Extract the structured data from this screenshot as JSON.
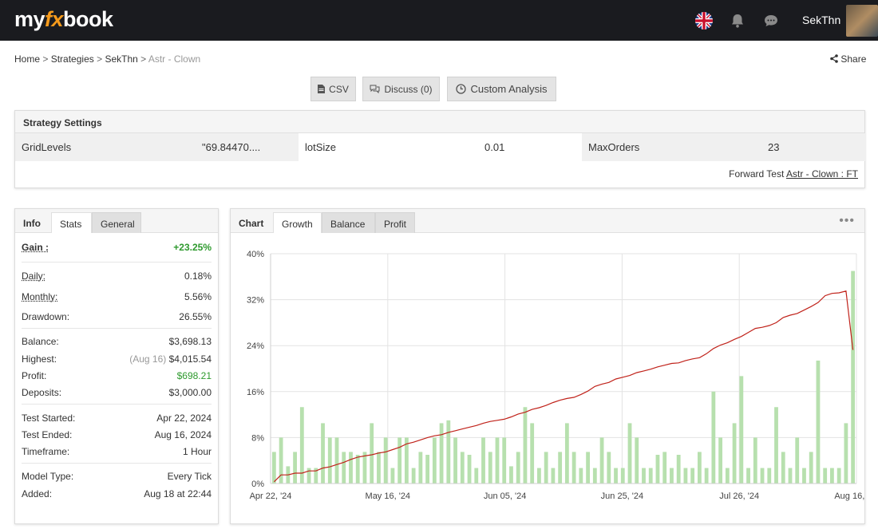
{
  "header": {
    "logo_pre": "my",
    "logo_fx": "fx",
    "logo_post": "book",
    "username": "SekThn"
  },
  "breadcrumb": {
    "home": "Home",
    "strategies": "Strategies",
    "user": "SekThn",
    "current": "Astr - Clown",
    "sep": ">"
  },
  "share_label": "Share",
  "toolbar": {
    "csv_label": "CSV",
    "discuss_label": "Discuss (0)",
    "analysis_label": "Custom Analysis"
  },
  "settings": {
    "title": "Strategy Settings",
    "params": [
      {
        "name": "GridLevels",
        "value": "\"69.84470...."
      },
      {
        "name": "lotSize",
        "value": "0.01"
      },
      {
        "name": "MaxOrders",
        "value": "23"
      }
    ],
    "forward_test_label": "Forward Test",
    "forward_test_link": "Astr - Clown : FT"
  },
  "left_tabs": [
    "Info",
    "Stats",
    "General"
  ],
  "stats": {
    "gain_label": "Gain :",
    "gain": "+23.25%",
    "daily_label": "Daily:",
    "daily": "0.18%",
    "monthly_label": "Monthly:",
    "monthly": "5.56%",
    "drawdown_label": "Drawdown:",
    "drawdown": "26.55%",
    "balance_label": "Balance:",
    "balance": "$3,698.13",
    "highest_label": "Highest:",
    "highest_date": "(Aug 16)",
    "highest": "$4,015.54",
    "profit_label": "Profit:",
    "profit": "$698.21",
    "deposits_label": "Deposits:",
    "deposits": "$3,000.00",
    "test_started_label": "Test Started:",
    "test_started": "Apr 22, 2024",
    "test_ended_label": "Test Ended:",
    "test_ended": "Aug 16, 2024",
    "timeframe_label": "Timeframe:",
    "timeframe": "1 Hour",
    "model_type_label": "Model Type:",
    "model_type": "Every Tick",
    "added_label": "Added:",
    "added": "Aug 18 at 22:44"
  },
  "chart_tabs": [
    "Chart",
    "Growth",
    "Balance",
    "Profit"
  ],
  "colors": {
    "line": "#c0221a",
    "bar": "#b7e0ae",
    "gain_green": "#2e9a2e",
    "logo_accent": "#f59a1b"
  },
  "chart_data": {
    "type": "bar",
    "ylim": [
      0,
      40
    ],
    "yticks": [
      "0%",
      "8%",
      "16%",
      "24%",
      "32%",
      "40%"
    ],
    "xticks": [
      "Apr 22, '24",
      "May 16, '24",
      "Jun 05, '24",
      "Jun 25, '24",
      "Jul 26, '24",
      "Aug 16, '24"
    ],
    "grid": true,
    "series": [
      {
        "values": [
          5.5,
          8,
          3,
          5.5,
          13.3,
          2.7,
          2.7,
          10.5,
          8,
          8,
          5.5,
          5.5,
          5,
          5.5,
          10.5,
          5.5,
          8,
          2.7,
          8,
          8,
          2.7,
          5.5,
          5,
          8,
          10.5,
          11,
          8,
          5.5,
          5,
          2.7,
          8,
          5.5,
          8,
          8,
          3,
          5.5,
          13.3,
          10.5,
          2.7,
          5.5,
          2.7,
          5.5,
          10.5,
          5.5,
          2.7,
          5.5,
          2.7,
          8,
          5.5,
          2.7,
          2.7,
          10.5,
          8,
          2.7,
          2.7,
          5,
          5.5,
          2.7,
          5,
          2.7,
          2.7,
          5.5,
          2.7,
          16,
          8,
          2.7,
          10.5,
          18.7,
          2.7,
          8,
          2.7,
          2.7,
          13.3,
          5.5,
          2.7,
          8,
          2.7,
          5.5,
          21.4,
          2.7,
          2.7,
          2.7,
          10.5,
          37
        ]
      },
      {
        "values": [
          0.3,
          1.5,
          1.5,
          1.8,
          1.8,
          2.2,
          2.2,
          2.7,
          2.9,
          3.3,
          3.7,
          4.2,
          4.6,
          4.8,
          5.0,
          5.3,
          5.5,
          5.9,
          6.3,
          6.9,
          7.2,
          7.6,
          8.0,
          8.3,
          8.5,
          8.9,
          9.2,
          9.5,
          9.8,
          10.1,
          10.5,
          10.8,
          11.0,
          11.2,
          11.6,
          12.1,
          12.4,
          12.9,
          13.2,
          13.6,
          14.1,
          14.5,
          14.8,
          15.0,
          15.5,
          16.1,
          16.9,
          17.3,
          17.6,
          18.2,
          18.5,
          18.8,
          19.3,
          19.6,
          19.9,
          20.3,
          20.6,
          20.9,
          21.0,
          21.4,
          21.7,
          21.9,
          22.6,
          23.5,
          24.1,
          24.5,
          25.1,
          25.6,
          26.3,
          27.0,
          27.2,
          27.5,
          28.0,
          28.9,
          29.3,
          29.6,
          30.2,
          30.8,
          31.5,
          32.7,
          33.1,
          33.2,
          33.5,
          23.25
        ]
      }
    ]
  }
}
